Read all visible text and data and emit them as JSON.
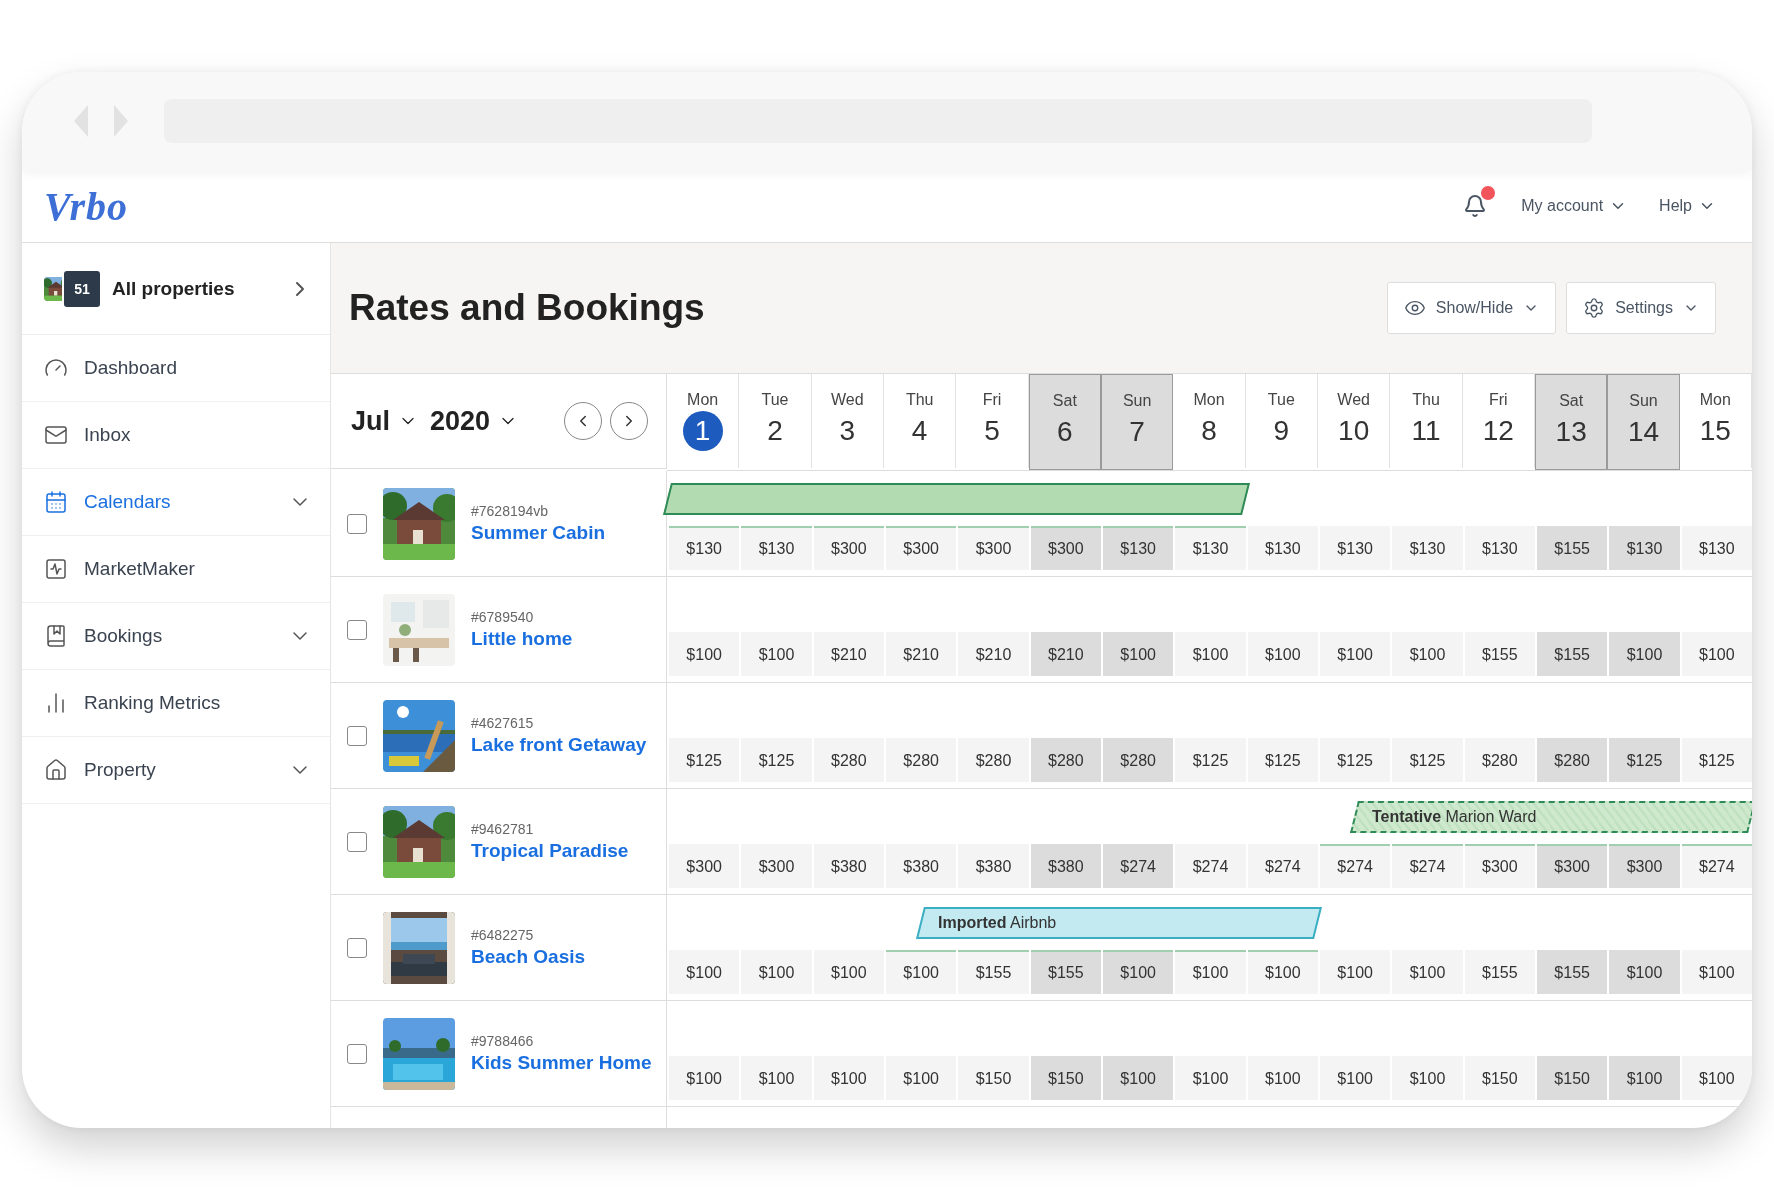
{
  "header": {
    "logo": "Vrbo",
    "notifications": {
      "unread": true
    },
    "menus": [
      {
        "label": "My account"
      },
      {
        "label": "Help"
      }
    ]
  },
  "sidebar": {
    "all_properties": {
      "count": "51",
      "label": "All properties"
    },
    "items": [
      {
        "label": "Dashboard",
        "kind": "dashboard",
        "selected": false,
        "has_submenu": false
      },
      {
        "label": "Inbox",
        "kind": "inbox",
        "selected": false,
        "has_submenu": false
      },
      {
        "label": "Calendars",
        "kind": "calendars",
        "selected": true,
        "has_submenu": true
      },
      {
        "label": "MarketMaker",
        "kind": "market",
        "selected": false,
        "has_submenu": false
      },
      {
        "label": "Bookings",
        "kind": "bookings",
        "selected": false,
        "has_submenu": true
      },
      {
        "label": "Ranking Metrics",
        "kind": "ranking",
        "selected": false,
        "has_submenu": false
      },
      {
        "label": "Property",
        "kind": "property",
        "selected": false,
        "has_submenu": true
      }
    ]
  },
  "page": {
    "title": "Rates and Bookings",
    "buttons": [
      {
        "label": "Show/Hide",
        "kind": "visibility"
      },
      {
        "label": "Settings",
        "kind": "settings"
      }
    ]
  },
  "calendar": {
    "month": "Jul",
    "year": "2020",
    "days": [
      {
        "weekday": "Mon",
        "date": "1",
        "today": true,
        "weekend": false
      },
      {
        "weekday": "Tue",
        "date": "2",
        "today": false,
        "weekend": false
      },
      {
        "weekday": "Wed",
        "date": "3",
        "today": false,
        "weekend": false
      },
      {
        "weekday": "Thu",
        "date": "4",
        "today": false,
        "weekend": false
      },
      {
        "weekday": "Fri",
        "date": "5",
        "today": false,
        "weekend": false
      },
      {
        "weekday": "Sat",
        "date": "6",
        "today": false,
        "weekend": true
      },
      {
        "weekday": "Sun",
        "date": "7",
        "today": false,
        "weekend": true
      },
      {
        "weekday": "Mon",
        "date": "8",
        "today": false,
        "weekend": false
      },
      {
        "weekday": "Tue",
        "date": "9",
        "today": false,
        "weekend": false
      },
      {
        "weekday": "Wed",
        "date": "10",
        "today": false,
        "weekend": false
      },
      {
        "weekday": "Thu",
        "date": "11",
        "today": false,
        "weekend": false
      },
      {
        "weekday": "Fri",
        "date": "12",
        "today": false,
        "weekend": false
      },
      {
        "weekday": "Sat",
        "date": "13",
        "today": false,
        "weekend": true
      },
      {
        "weekday": "Sun",
        "date": "14",
        "today": false,
        "weekend": true
      },
      {
        "weekday": "Mon",
        "date": "15",
        "today": false,
        "weekend": false
      }
    ]
  },
  "rows": [
    {
      "id": "#7628194vb",
      "name": "Summer Cabin",
      "checked": false,
      "booking": {
        "kind": "confirmed"
      },
      "cells": [
        {
          "price": "$130",
          "booked": true
        },
        {
          "price": "$130",
          "booked": true
        },
        {
          "price": "$300",
          "booked": true
        },
        {
          "price": "$300",
          "booked": true
        },
        {
          "price": "$300",
          "booked": true
        },
        {
          "price": "$300",
          "booked": true
        },
        {
          "price": "$130",
          "booked": true
        },
        {
          "price": "$130",
          "booked": true
        },
        {
          "price": "$130",
          "booked": false
        },
        {
          "price": "$130",
          "booked": false
        },
        {
          "price": "$130",
          "booked": false
        },
        {
          "price": "$130",
          "booked": false
        },
        {
          "price": "$155",
          "booked": false
        },
        {
          "price": "$130",
          "booked": false
        },
        {
          "price": "$130",
          "booked": false
        }
      ]
    },
    {
      "id": "#6789540",
      "name": "Little home",
      "checked": false,
      "cells": [
        {
          "price": "$100",
          "booked": false
        },
        {
          "price": "$100",
          "booked": false
        },
        {
          "price": "$210",
          "booked": false
        },
        {
          "price": "$210",
          "booked": false
        },
        {
          "price": "$210",
          "booked": false
        },
        {
          "price": "$210",
          "booked": false
        },
        {
          "price": "$100",
          "booked": false
        },
        {
          "price": "$100",
          "booked": false
        },
        {
          "price": "$100",
          "booked": false
        },
        {
          "price": "$100",
          "booked": false
        },
        {
          "price": "$100",
          "booked": false
        },
        {
          "price": "$155",
          "booked": false
        },
        {
          "price": "$155",
          "booked": false
        },
        {
          "price": "$100",
          "booked": false
        },
        {
          "price": "$100",
          "booked": false
        }
      ]
    },
    {
      "id": "#4627615",
      "name": "Lake front Getaway",
      "checked": false,
      "cells": [
        {
          "price": "$125",
          "booked": false
        },
        {
          "price": "$125",
          "booked": false
        },
        {
          "price": "$280",
          "booked": false
        },
        {
          "price": "$280",
          "booked": false
        },
        {
          "price": "$280",
          "booked": false
        },
        {
          "price": "$280",
          "booked": false
        },
        {
          "price": "$280",
          "booked": false
        },
        {
          "price": "$125",
          "booked": false
        },
        {
          "price": "$125",
          "booked": false
        },
        {
          "price": "$125",
          "booked": false
        },
        {
          "price": "$125",
          "booked": false
        },
        {
          "price": "$280",
          "booked": false
        },
        {
          "price": "$280",
          "booked": false
        },
        {
          "price": "$125",
          "booked": false
        },
        {
          "price": "$125",
          "booked": false
        }
      ]
    },
    {
      "id": "#9462781",
      "name": "Tropical Paradise",
      "checked": false,
      "booking": {
        "kind": "tentative",
        "label": "**Tentative** Marion Ward"
      },
      "cells": [
        {
          "price": "$300",
          "booked": false
        },
        {
          "price": "$300",
          "booked": false
        },
        {
          "price": "$380",
          "booked": false
        },
        {
          "price": "$380",
          "booked": false
        },
        {
          "price": "$380",
          "booked": false
        },
        {
          "price": "$380",
          "booked": false
        },
        {
          "price": "$274",
          "booked": false
        },
        {
          "price": "$274",
          "booked": false
        },
        {
          "price": "$274",
          "booked": false
        },
        {
          "price": "$274",
          "booked": true
        },
        {
          "price": "$274",
          "booked": true
        },
        {
          "price": "$300",
          "booked": true
        },
        {
          "price": "$300",
          "booked": true
        },
        {
          "price": "$300",
          "booked": true
        },
        {
          "price": "$274",
          "booked": true
        }
      ]
    },
    {
      "id": "#6482275",
      "name": "Beach Oasis",
      "checked": false,
      "booking": {
        "kind": "imported",
        "label": "**Imported** Airbnb"
      },
      "cells": [
        {
          "price": "$100",
          "booked": false
        },
        {
          "price": "$100",
          "booked": false
        },
        {
          "price": "$100",
          "booked": false
        },
        {
          "price": "$100",
          "booked": true
        },
        {
          "price": "$155",
          "booked": true
        },
        {
          "price": "$155",
          "booked": true
        },
        {
          "price": "$100",
          "booked": true
        },
        {
          "price": "$100",
          "booked": true
        },
        {
          "price": "$100",
          "booked": true
        },
        {
          "price": "$100",
          "booked": false
        },
        {
          "price": "$100",
          "booked": false
        },
        {
          "price": "$155",
          "booked": false
        },
        {
          "price": "$155",
          "booked": false
        },
        {
          "price": "$100",
          "booked": false
        },
        {
          "price": "$100",
          "booked": false
        }
      ]
    },
    {
      "id": "#9788466",
      "name": "Kids Summer Home",
      "checked": false,
      "cells": [
        {
          "price": "$100",
          "booked": false
        },
        {
          "price": "$100",
          "booked": false
        },
        {
          "price": "$100",
          "booked": false
        },
        {
          "price": "$100",
          "booked": false
        },
        {
          "price": "$150",
          "booked": false
        },
        {
          "price": "$150",
          "booked": false
        },
        {
          "price": "$100",
          "booked": false
        },
        {
          "price": "$100",
          "booked": false
        },
        {
          "price": "$100",
          "booked": false
        },
        {
          "price": "$100",
          "booked": false
        },
        {
          "price": "$100",
          "booked": false
        },
        {
          "price": "$150",
          "booked": false
        },
        {
          "price": "$150",
          "booked": false
        },
        {
          "price": "$100",
          "booked": false
        },
        {
          "price": "$100",
          "booked": false
        }
      ]
    }
  ]
}
